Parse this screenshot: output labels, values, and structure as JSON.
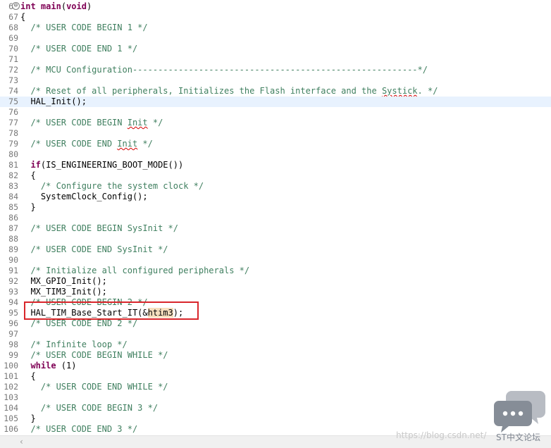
{
  "editor": {
    "current_line": "75",
    "lines": [
      {
        "num": "66",
        "fold": "⊖",
        "tokens": [
          {
            "t": "int",
            "c": "kw"
          },
          {
            "t": " ",
            "c": "tx"
          },
          {
            "t": "main",
            "c": "kw"
          },
          {
            "t": "(",
            "c": "tx"
          },
          {
            "t": "void",
            "c": "kw"
          },
          {
            "t": ")",
            "c": "tx"
          }
        ]
      },
      {
        "num": "67",
        "tokens": [
          {
            "t": "{",
            "c": "tx"
          }
        ]
      },
      {
        "num": "68",
        "tokens": [
          {
            "t": "  /* USER CODE BEGIN 1 */",
            "c": "cm"
          }
        ]
      },
      {
        "num": "69",
        "tokens": []
      },
      {
        "num": "70",
        "tokens": [
          {
            "t": "  /* USER CODE END 1 */",
            "c": "cm"
          }
        ]
      },
      {
        "num": "71",
        "tokens": []
      },
      {
        "num": "72",
        "tokens": [
          {
            "t": "  /* MCU Configuration--------------------------------------------------------*/",
            "c": "cm"
          }
        ]
      },
      {
        "num": "73",
        "tokens": []
      },
      {
        "num": "74",
        "tokens": [
          {
            "t": "  /* Reset of all peripherals, Initializes the Flash interface and the ",
            "c": "cm"
          },
          {
            "t": "Systick",
            "c": "sp"
          },
          {
            "t": ". */",
            "c": "cm"
          }
        ]
      },
      {
        "num": "75",
        "tokens": [
          {
            "t": "  HAL_Init();",
            "c": "tx"
          }
        ]
      },
      {
        "num": "76",
        "tokens": []
      },
      {
        "num": "77",
        "tokens": [
          {
            "t": "  /* USER CODE BEGIN ",
            "c": "cm"
          },
          {
            "t": "Init",
            "c": "sp"
          },
          {
            "t": " */",
            "c": "cm"
          }
        ]
      },
      {
        "num": "78",
        "tokens": []
      },
      {
        "num": "79",
        "tokens": [
          {
            "t": "  /* USER CODE END ",
            "c": "cm"
          },
          {
            "t": "Init",
            "c": "sp"
          },
          {
            "t": " */",
            "c": "cm"
          }
        ]
      },
      {
        "num": "80",
        "tokens": []
      },
      {
        "num": "81",
        "tokens": [
          {
            "t": "  ",
            "c": "tx"
          },
          {
            "t": "if",
            "c": "kw"
          },
          {
            "t": "(IS_ENGINEERING_BOOT_MODE())",
            "c": "tx"
          }
        ]
      },
      {
        "num": "82",
        "tokens": [
          {
            "t": "  {",
            "c": "tx"
          }
        ]
      },
      {
        "num": "83",
        "tokens": [
          {
            "t": "    /* Configure the system clock */",
            "c": "cm"
          }
        ]
      },
      {
        "num": "84",
        "tokens": [
          {
            "t": "    SystemClock_Config();",
            "c": "tx"
          }
        ]
      },
      {
        "num": "85",
        "tokens": [
          {
            "t": "  }",
            "c": "tx"
          }
        ]
      },
      {
        "num": "86",
        "tokens": []
      },
      {
        "num": "87",
        "tokens": [
          {
            "t": "  /* USER CODE BEGIN SysInit */",
            "c": "cm"
          }
        ]
      },
      {
        "num": "88",
        "tokens": []
      },
      {
        "num": "89",
        "tokens": [
          {
            "t": "  /* USER CODE END SysInit */",
            "c": "cm"
          }
        ]
      },
      {
        "num": "90",
        "tokens": []
      },
      {
        "num": "91",
        "tokens": [
          {
            "t": "  /* Initialize all configured peripherals */",
            "c": "cm"
          }
        ]
      },
      {
        "num": "92",
        "tokens": [
          {
            "t": "  MX_GPIO_Init();",
            "c": "tx"
          }
        ]
      },
      {
        "num": "93",
        "tokens": [
          {
            "t": "  MX_TIM3_Init();",
            "c": "tx"
          }
        ]
      },
      {
        "num": "94",
        "tokens": [
          {
            "t": "  /* USER CODE BEGIN 2 */",
            "c": "cm"
          }
        ]
      },
      {
        "num": "95",
        "tokens": [
          {
            "t": "  HAL_TIM_Base_Start_IT(&",
            "c": "tx"
          },
          {
            "t": "htim3",
            "c": "hl"
          },
          {
            "t": ");",
            "c": "tx"
          }
        ]
      },
      {
        "num": "96",
        "tokens": [
          {
            "t": "  /* USER CODE END 2 */",
            "c": "cm"
          }
        ]
      },
      {
        "num": "97",
        "tokens": []
      },
      {
        "num": "98",
        "tokens": [
          {
            "t": "  /* Infinite loop */",
            "c": "cm"
          }
        ]
      },
      {
        "num": "99",
        "tokens": [
          {
            "t": "  /* USER CODE BEGIN WHILE */",
            "c": "cm"
          }
        ]
      },
      {
        "num": "100",
        "tokens": [
          {
            "t": "  ",
            "c": "tx"
          },
          {
            "t": "while",
            "c": "kw"
          },
          {
            "t": " (1)",
            "c": "tx"
          }
        ]
      },
      {
        "num": "101",
        "tokens": [
          {
            "t": "  {",
            "c": "tx"
          }
        ]
      },
      {
        "num": "102",
        "tokens": [
          {
            "t": "    /* USER CODE END WHILE */",
            "c": "cm"
          }
        ]
      },
      {
        "num": "103",
        "tokens": []
      },
      {
        "num": "104",
        "tokens": [
          {
            "t": "    /* USER CODE BEGIN 3 */",
            "c": "cm"
          }
        ]
      },
      {
        "num": "105",
        "tokens": [
          {
            "t": "  }",
            "c": "tx"
          }
        ]
      },
      {
        "num": "106",
        "tokens": [
          {
            "t": "  /* USER CODE END 3 */",
            "c": "cm"
          }
        ]
      }
    ]
  },
  "colors": {
    "comment": "#3f7f5f",
    "keyword": "#7f0055",
    "current_line_bg": "#e8f2fe",
    "occurrence_highlight": "#f6dfbe",
    "annotation_box": "#d9262b"
  },
  "scrollbar": {
    "left_arrow": "‹"
  },
  "watermark": {
    "url": "https://blog.csdn.net/",
    "logo_text": "ST中文论坛",
    "logo_icon": "chat-bubbles-icon"
  }
}
